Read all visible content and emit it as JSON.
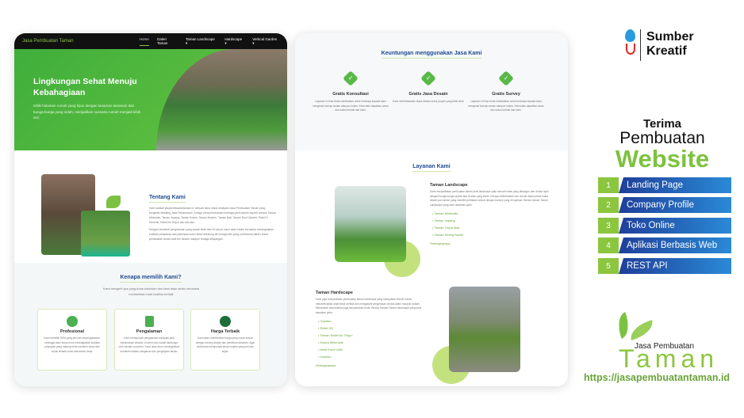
{
  "left_site": {
    "nav": {
      "logo": "Jasa Pembuatan Taman",
      "items": [
        "Home",
        "Galeri Taman",
        "Taman Landscape ▾",
        "Hardscape ▾",
        "Vertical Garden ▾"
      ]
    },
    "hero": {
      "title": "Lingkungan Sehat Menuju Kebahagiaan",
      "text": "Miliki halaman rumah yang hijau dengan tanaman-tanaman dan bunga-bunga yang indah, menjadikan suasana rumah menjadi lebih asri."
    },
    "about": {
      "title": "Tentang Kami",
      "p1": "Kami adalah jasapembuatantaman.id, sebuah situs untuk melayani Jasa Pembuatan Taman yang bergerak dibidang Jasa Pertamanan. Design serta pembuatan berbagai jenis taman seperti konsep Taman Minimalis, Taman Jepang, Taman Kolam, Taman Modern, Taman Bali, Taman Roof Garden, Relief 3 Dimensi, Relief Air Terjun dan lain-lain.",
      "p2": "Dengan berbekal pengalaman yang sudah lebih dari 10 tahun, kami akan selalu berusaha meningkatkan kualitas pelayanan dan pekerjaan kami serta didukung tim tenaga ahli yang profesional dalam dunia pembuatan taman baik tim desain maupun tenaga dilapangan."
    },
    "why": {
      "title": "Kenapa memilih Kami?",
      "subtitle": "Kami mengerti apa yang Anda butuhkan dan kami akan selalu berusaha memberikan hasil kualitas terbaik",
      "cards": [
        {
          "title": "Profesional",
          "text": "Kami memiliki SDM yang ahli dan berpengalaman, sehingga kami fokus terus meningkatkan kualitas pekerjaan yang matang serta memberi saran dan solusi terbaik untuk kebutuhan Anda."
        },
        {
          "title": "Pengalaman",
          "text": "Kami mempunyai pengalaman melayani jasa pertamanan selama 10 tahun dan sudah dipercaya oleh ratusan customer. Kami akan terus meningkatkan komitmen dalam pelayanan dan pengerjaan taman."
        },
        {
          "title": "Harga Terbaik",
          "text": "Kami akan memberikan harga yang cocok sesuai dengan konsep desain dan pemilihan tanaman. Agar Anda bisa mempunyai taman impian yang asri dan sejuk."
        }
      ]
    }
  },
  "right_site": {
    "benefits": {
      "title": "Keuntungan menggunakan Jasa Kami",
      "items": [
        {
          "title": "Gratis Konsultasi",
          "text": "Layanan ini bisa Anda manfaatkan untuk bertanya kepada kami mengenai konsep taman ataupun kolam. Kemudian dapatkan saran dan solusi terbaik dari kami."
        },
        {
          "title": "Gratis Jasa Desain",
          "text": "Kami membebaskan biaya desain untuk proyek yang telah deal."
        },
        {
          "title": "Gratis Survey",
          "text": "Layanan ini bisa Anda manfaatkan untuk bertanya kepada kami mengenai konsep taman ataupun kolam. Kemudian dapatkan saran dan solusi terbaik dari kami."
        }
      ]
    },
    "services": {
      "title": "Layanan Kami",
      "landscape": {
        "title": "Taman Landscape",
        "text": "Kami menyediakan pembuatan taman jenis landscape yaitu sebuah lahan yang dibangun dan di tata rapih dengan bunga-bunga seperti ada di alam yang indah. Dengan didiskusikan dan sesuai dalam pihak maka desain pun taman yang memiliki penataan sesuai dengan konsep yang di inginkan. Berikut desain Taman Landscape yang kami tawarkan yaitu:",
        "items": [
          "Taman Minimalis",
          "Taman Jepang",
          "Taman Tropis Bali",
          "Taman Kering Boulle"
        ],
        "more": "Selengkapnya"
      },
      "hardscape": {
        "title": "Taman Hardscape",
        "text": "Kami juga menyediakan pembuatan taman hardscape yang merupakan elemen keras, mendefinisikan objek tidak vertikal dan mengatami pengerasan secara alami maupun buatan. Menambah nilai estetika juga kenyamanan Anda. Berikut Desain Taman Hardscape yang kami tawarkan yaitu:",
        "items": [
          "Gazebo",
          "Relief 3D",
          "Taman Relief Air Terjun",
          "Kolam Minimalis",
          "Motif Koral Ubel",
          "Gazebo"
        ],
        "more": "Selengkapnya"
      }
    }
  },
  "brand": {
    "name_line1": "Sumber",
    "name_line2": "Kreatif"
  },
  "promo": {
    "line1": "Terima",
    "line2": "Pembuatan",
    "line3": "Website",
    "accent": "#7dc23f",
    "services": [
      {
        "n": "1",
        "label": "Landing Page"
      },
      {
        "n": "2",
        "label": "Company Profile"
      },
      {
        "n": "3",
        "label": "Toko Online"
      },
      {
        "n": "4",
        "label": "Aplikasi Berbasis Web"
      },
      {
        "n": "5",
        "label": "REST API"
      }
    ]
  },
  "taman_logo": {
    "small": "Jasa Pembuatan",
    "big": "Taman",
    "url": "https://jasapembuatantaman.id"
  }
}
